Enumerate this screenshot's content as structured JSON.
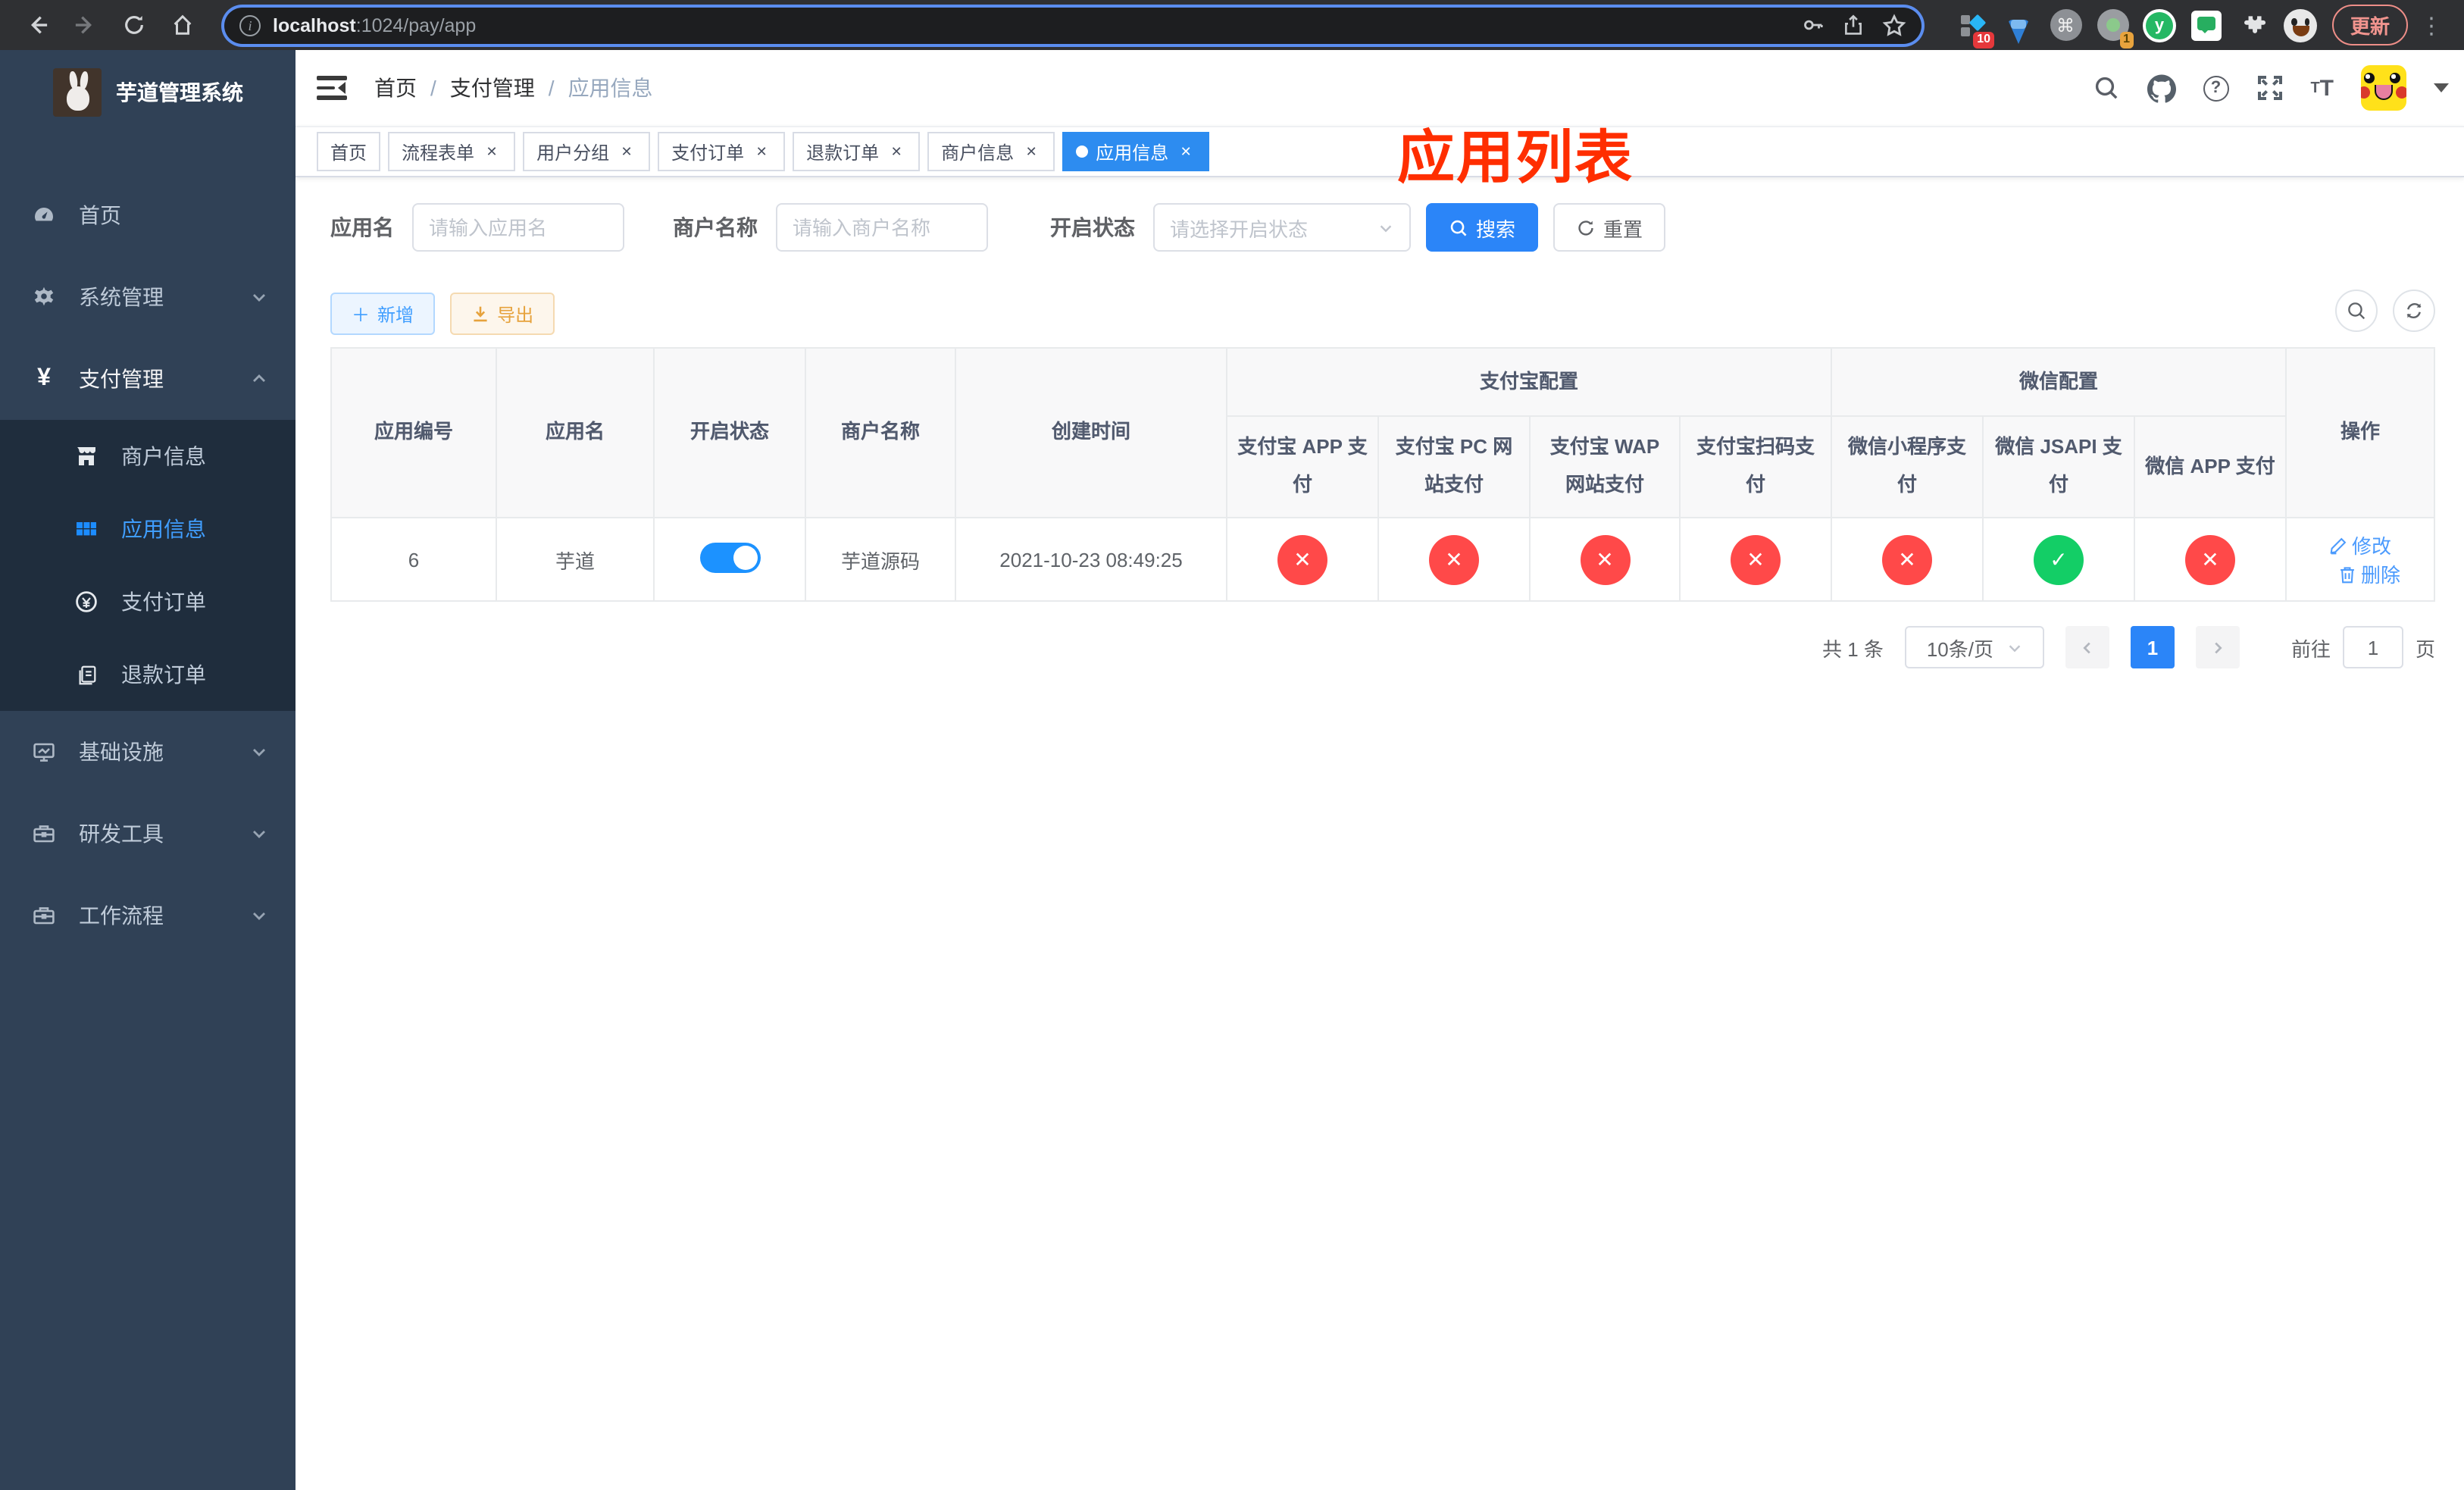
{
  "browser": {
    "url_host": "localhost",
    "url_rest": ":1024/pay/app",
    "ext_badge_blue_grid": "10",
    "ext_badge_recorder": "1",
    "ext_y_letter": "y",
    "cmd_glyph": "⌘",
    "update_label": "更新"
  },
  "sidebar": {
    "app_title": "芋道管理系统",
    "home": "首页",
    "system": "系统管理",
    "payment": "支付管理",
    "pay_children": [
      {
        "label": "商户信息"
      },
      {
        "label": "应用信息"
      },
      {
        "label": "支付订单"
      },
      {
        "label": "退款订单"
      }
    ],
    "infra": "基础设施",
    "dev_tools": "研发工具",
    "workflow": "工作流程"
  },
  "header": {
    "breadcrumb": [
      "首页",
      "支付管理",
      "应用信息"
    ],
    "overlay_title": "应用列表"
  },
  "tabs": [
    {
      "label": "首页"
    },
    {
      "label": "流程表单"
    },
    {
      "label": "用户分组"
    },
    {
      "label": "支付订单"
    },
    {
      "label": "退款订单"
    },
    {
      "label": "商户信息"
    },
    {
      "label": "应用信息"
    }
  ],
  "filters": {
    "app_name_label": "应用名",
    "app_name_placeholder": "请输入应用名",
    "merchant_label": "商户名称",
    "merchant_placeholder": "请输入商户名称",
    "status_label": "开启状态",
    "status_placeholder": "请选择开启状态",
    "search_label": "搜索",
    "reset_label": "重置"
  },
  "toolbar": {
    "add_label": "新增",
    "export_label": "导出"
  },
  "table": {
    "columns": {
      "id": "应用编号",
      "name": "应用名",
      "status": "开启状态",
      "merchant": "商户名称",
      "created": "创建时间",
      "op": "操作"
    },
    "groups": {
      "alipay": "支付宝配置",
      "wechat": "微信配置"
    },
    "sub_columns": [
      "支付宝 APP 支付",
      "支付宝 PC 网站支付",
      "支付宝 WAP 网站支付",
      "支付宝扫码支付",
      "微信小程序支付",
      "微信 JSAPI 支付",
      "微信 APP 支付"
    ],
    "row": {
      "id": "6",
      "name": "芋道",
      "enabled": "on",
      "merchant": "芋道源码",
      "created": "2021-10-23 08:49:25",
      "channels": [
        "disabled",
        "disabled",
        "disabled",
        "disabled",
        "disabled",
        "enabled",
        "disabled"
      ],
      "edit_label": "修改",
      "delete_label": "删除"
    }
  },
  "pagination": {
    "total": "共 1 条",
    "page_size": "10条/页",
    "current_page": "1",
    "goto_label": "前往",
    "goto_value": "1",
    "page_suffix": "页"
  }
}
